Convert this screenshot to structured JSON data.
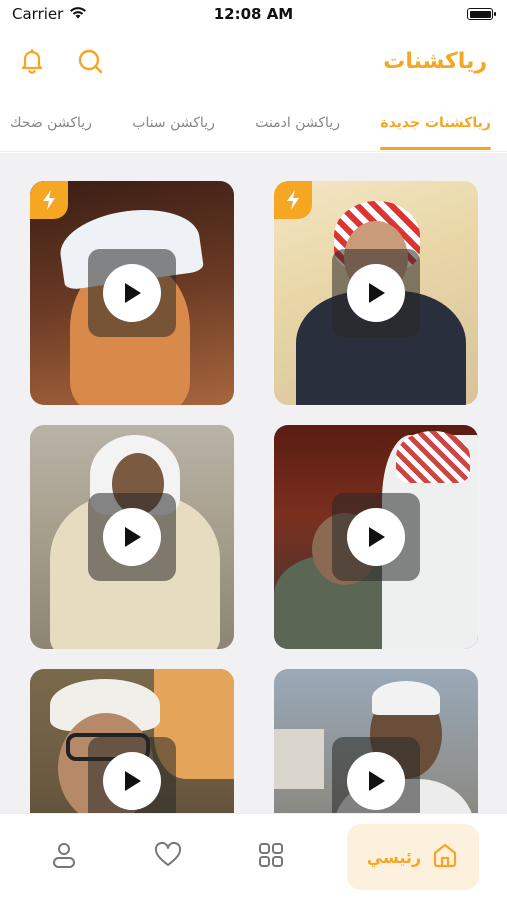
{
  "status": {
    "carrier": "Carrier",
    "time": "12:08 AM"
  },
  "header": {
    "title": "رياكشنات"
  },
  "tabs": [
    {
      "label": "رياكشنات جديدة",
      "active": true
    },
    {
      "label": "رياكشن ادمنت",
      "active": false
    },
    {
      "label": "رياكشن سناب",
      "active": false
    },
    {
      "label": "رياكشن ضحك",
      "active": false
    }
  ],
  "bottom_nav": {
    "home_label": "رئيسي"
  },
  "colors": {
    "accent": "#f5a623",
    "grid_bg": "#f1f1f3"
  },
  "icons": [
    "bell-icon",
    "search-icon",
    "flash-icon",
    "play-icon",
    "home-icon",
    "grid-icon",
    "heart-icon",
    "user-icon"
  ]
}
